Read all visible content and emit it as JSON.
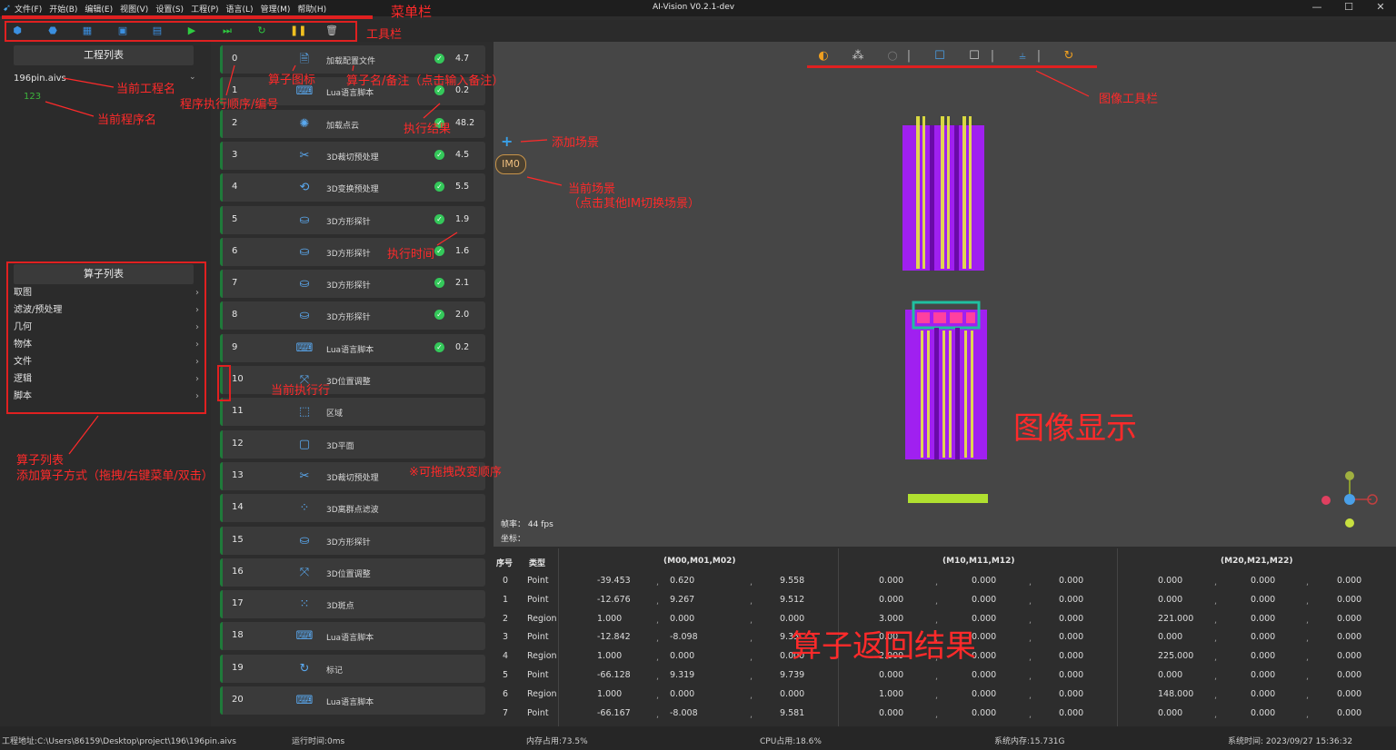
{
  "app": {
    "title": "AI-Vision V0.2.1-dev",
    "logo_icon": "app-logo-icon"
  },
  "menu": [
    "文件(F)",
    "开始(B)",
    "编辑(E)",
    "视图(V)",
    "设置(S)",
    "工程(P)",
    "语言(L)",
    "管理(M)",
    "帮助(H)"
  ],
  "toolbar": {
    "icons": [
      "open-project-icon",
      "import-icon",
      "export-icon",
      "save-icon",
      "save-as-icon",
      "run-icon",
      "run-step-icon",
      "loop-icon",
      "pause-icon",
      "delete-icon"
    ]
  },
  "left": {
    "project_panel_title": "工程列表",
    "project_name": "196pin.aivs",
    "program_name": "123",
    "operator_panel_title": "算子列表",
    "categories": [
      "取图",
      "滤波/预处理",
      "几何",
      "物体",
      "文件",
      "逻辑",
      "脚本"
    ]
  },
  "steps": [
    {
      "idx": "0",
      "name": "加载配置文件",
      "icon": "file-icon",
      "ok": true,
      "time": "4.7"
    },
    {
      "idx": "1",
      "name": "Lua语言脚本",
      "icon": "script-icon",
      "ok": true,
      "time": "0.2"
    },
    {
      "idx": "2",
      "name": "加载点云",
      "icon": "pointcloud-icon",
      "ok": true,
      "time": "48.2"
    },
    {
      "idx": "3",
      "name": "3D裁切预处理",
      "icon": "scissors-icon",
      "ok": true,
      "time": "4.5"
    },
    {
      "idx": "4",
      "name": "3D变换预处理",
      "icon": "transform-icon",
      "ok": true,
      "time": "5.5"
    },
    {
      "idx": "5",
      "name": "3D方形探针",
      "icon": "probe-icon",
      "ok": true,
      "time": "1.9"
    },
    {
      "idx": "6",
      "name": "3D方形探针",
      "icon": "probe-icon",
      "ok": true,
      "time": "1.6"
    },
    {
      "idx": "7",
      "name": "3D方形探针",
      "icon": "probe-icon",
      "ok": true,
      "time": "2.1"
    },
    {
      "idx": "8",
      "name": "3D方形探针",
      "icon": "probe-icon",
      "ok": true,
      "time": "2.0"
    },
    {
      "idx": "9",
      "name": "Lua语言脚本",
      "icon": "script-icon",
      "ok": true,
      "time": "0.2"
    },
    {
      "idx": "10",
      "name": "3D位置调整",
      "icon": "position-icon",
      "ok": false,
      "time": ""
    },
    {
      "idx": "11",
      "name": "区域",
      "icon": "region-icon",
      "ok": false,
      "time": ""
    },
    {
      "idx": "12",
      "name": "3D平面",
      "icon": "plane-icon",
      "ok": false,
      "time": ""
    },
    {
      "idx": "13",
      "name": "3D裁切预处理",
      "icon": "scissors-icon",
      "ok": false,
      "time": ""
    },
    {
      "idx": "14",
      "name": "3D离群点滤波",
      "icon": "filter-icon",
      "ok": false,
      "time": ""
    },
    {
      "idx": "15",
      "name": "3D方形探针",
      "icon": "probe-icon",
      "ok": false,
      "time": ""
    },
    {
      "idx": "16",
      "name": "3D位置调整",
      "icon": "position-icon",
      "ok": false,
      "time": ""
    },
    {
      "idx": "17",
      "name": "3D斑点",
      "icon": "blob-icon",
      "ok": false,
      "time": ""
    },
    {
      "idx": "18",
      "name": "Lua语言脚本",
      "icon": "script-icon",
      "ok": false,
      "time": ""
    },
    {
      "idx": "19",
      "name": "标记",
      "icon": "refresh-icon",
      "ok": false,
      "time": ""
    },
    {
      "idx": "20",
      "name": "Lua语言脚本",
      "icon": "script-icon",
      "ok": false,
      "time": ""
    }
  ],
  "image": {
    "scene": "IM0",
    "fps_label": "帧率：",
    "fps_value": "44 fps",
    "coord_label": "坐标：",
    "tool_icons": [
      "color-icon",
      "points-icon",
      "circle-icon",
      "square-blue-icon",
      "square-icon",
      "align-icon",
      "reset-icon"
    ]
  },
  "results": {
    "headers": [
      "序号",
      "类型",
      "(M00,M01,M02)",
      "(M10,M11,M12)",
      "(M20,M21,M22)"
    ],
    "rows": [
      [
        "0",
        "Point",
        "-39.453",
        "0.620",
        "9.558",
        "0.000",
        "0.000",
        "0.000",
        "0.000",
        "0.000",
        "0.000"
      ],
      [
        "1",
        "Point",
        "-12.676",
        "9.267",
        "9.512",
        "0.000",
        "0.000",
        "0.000",
        "0.000",
        "0.000",
        "0.000"
      ],
      [
        "2",
        "Region",
        "1.000",
        "0.000",
        "0.000",
        "3.000",
        "0.000",
        "0.000",
        "221.000",
        "0.000",
        "0.000"
      ],
      [
        "3",
        "Point",
        "-12.842",
        "-8.098",
        "9.35",
        "0.00",
        "0.000",
        "0.000",
        "0.000",
        "0.000",
        "0.000"
      ],
      [
        "4",
        "Region",
        "1.000",
        "0.000",
        "0.000",
        "2.000",
        "0.000",
        "0.000",
        "225.000",
        "0.000",
        "0.000"
      ],
      [
        "5",
        "Point",
        "-66.128",
        "9.319",
        "9.739",
        "0.000",
        "0.000",
        "0.000",
        "0.000",
        "0.000",
        "0.000"
      ],
      [
        "6",
        "Region",
        "1.000",
        "0.000",
        "0.000",
        "1.000",
        "0.000",
        "0.000",
        "148.000",
        "0.000",
        "0.000"
      ],
      [
        "7",
        "Point",
        "-66.167",
        "-8.008",
        "9.581",
        "0.000",
        "0.000",
        "0.000",
        "0.000",
        "0.000",
        "0.000"
      ]
    ]
  },
  "status": {
    "path": "工程地址:C:\\Users\\86159\\Desktop\\project\\196\\196pin.aivs",
    "runtime": "运行时间:0ms",
    "memory": "内存占用:73.5%",
    "cpu": "CPU占用:18.6%",
    "sysmem": "系统内存:15.731G",
    "systime": "系统时间: 2023/09/27 15:36:32"
  },
  "annotations": {
    "menubar": "菜单栏",
    "toolbar": "工具栏",
    "current_project": "当前工程名",
    "current_program": "当前程序名",
    "step_icon": "算子图标",
    "step_name": "算子名/备注（点击输入备注）",
    "step_order": "程序执行顺序/编号",
    "exec_result": "执行结果",
    "exec_time": "执行时间",
    "current_row": "当前执行行",
    "drag_order": "※可拖拽改变顺序",
    "operator_list_1": "算子列表",
    "operator_list_2": "添加算子方式（拖拽/右键菜单/双击）",
    "add_scene": "添加场景",
    "current_scene_1": "当前场景",
    "current_scene_2": "（点击其他IM切换场景）",
    "image_toolbar": "图像工具栏",
    "image_display": "图像显示",
    "results": "算子返回结果"
  },
  "colors": {
    "accent": "#39a0e8",
    "ok": "#34c85a",
    "annotation": "#ff2a2a",
    "pointcloud": "#a020f0"
  }
}
